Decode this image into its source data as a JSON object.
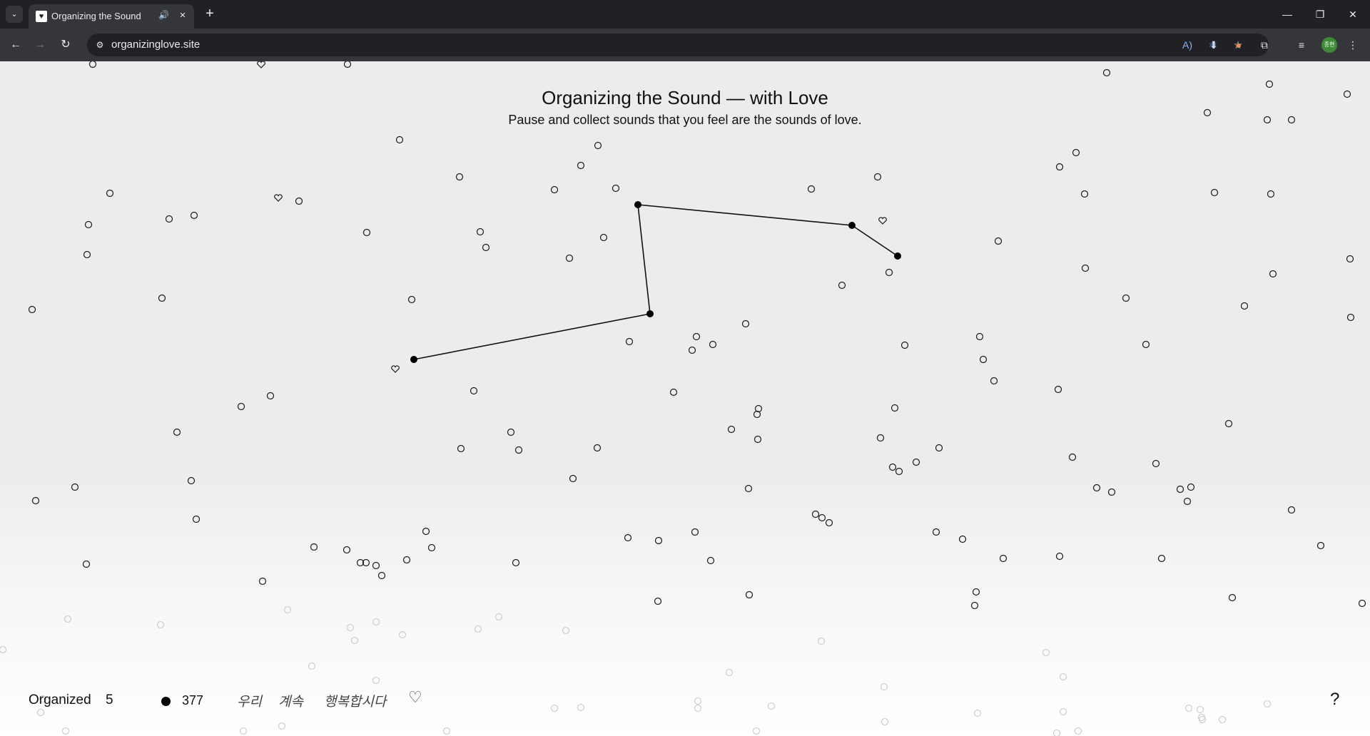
{
  "browser": {
    "tab_title": "Organizing the Sound",
    "url": "organizinglove.site",
    "profile_initials": "종현"
  },
  "page": {
    "title": "Organizing the Sound — with Love",
    "subtitle": "Pause and collect sounds that you feel are the sounds of love."
  },
  "footer": {
    "organized_label": "Organized",
    "organized_count": "5",
    "total_count": "377",
    "phrase_words": [
      "우리",
      "계속",
      "행복합시다"
    ],
    "help_label": "?"
  },
  "icons": {
    "tab_menu": "chevron-down-icon",
    "favicon": "heart-icon",
    "audio": "speaker-icon",
    "info": "site-info-icon",
    "back": "arrow-left-icon",
    "forward": "arrow-right-icon",
    "reload": "reload-icon",
    "install": "install-app-icon",
    "bookmark": "star-icon",
    "extensions": "puzzle-icon",
    "media": "media-controls-icon",
    "dot": "filled-circle-icon",
    "heart": "heart-icon",
    "help": "question-mark-icon"
  },
  "colors": {
    "chrome_dark": "#202124",
    "chrome_mid": "#35363a",
    "page_bg": "#ececec",
    "ink": "#111111"
  }
}
